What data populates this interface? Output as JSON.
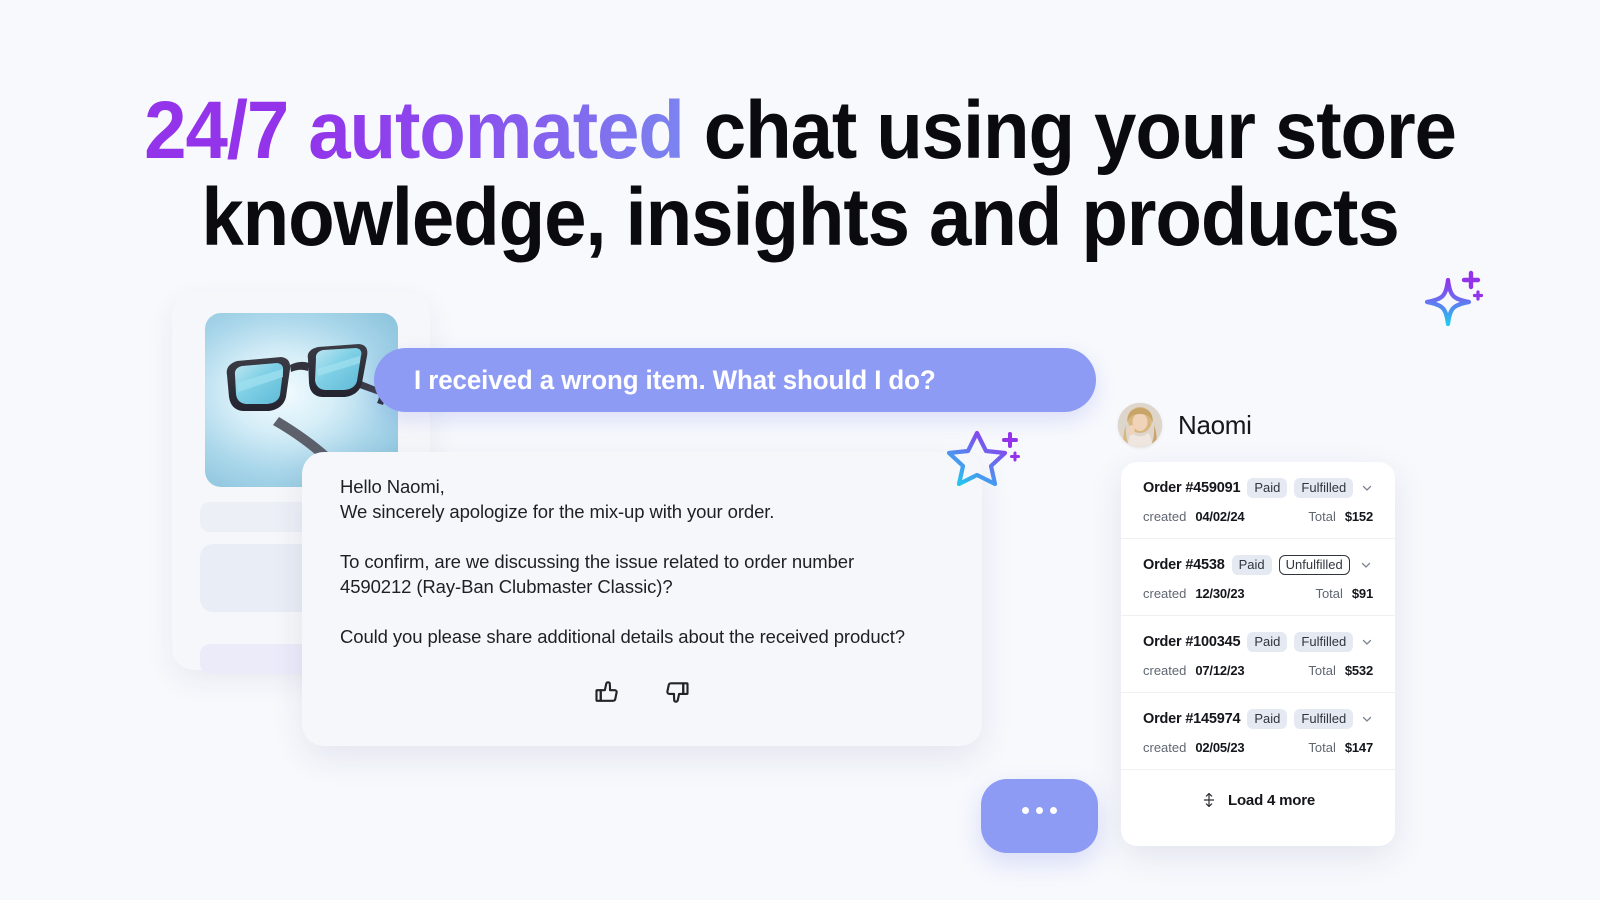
{
  "headline": {
    "gradient_part": "24/7 automated",
    "line1_rest": " chat using your store",
    "line2": "knowledge, insights and products",
    "gradient_from": "#9333EA",
    "gradient_to": "#7B85EF",
    "text_color": "#0B0B0F"
  },
  "product_card": {
    "image_alt": "sunglasses-product-image"
  },
  "chat": {
    "user_message": "I received a wrong item. What should I do?",
    "user_bubble_color": "#8E9BF5",
    "bot_message": {
      "line1": "Hello Naomi,",
      "line2": "We sincerely apologize for the mix-up with your order.",
      "line3": "To confirm, are we discussing the issue related to order number",
      "line4": "4590212 (Ray-Ban Clubmaster Classic)?",
      "line5": "Could you please share additional details about the received product?"
    },
    "thumbs_up": "thumbs-up-icon",
    "thumbs_down": "thumbs-down-icon",
    "typing_indicator": "•••"
  },
  "customer": {
    "name": "Naomi",
    "avatar": "user-avatar-photo"
  },
  "orders_panel": {
    "labels": {
      "created": "created",
      "total": "Total"
    },
    "rows": [
      {
        "id": "Order #459091",
        "status_payment": "Paid",
        "status_fulfillment": "Fulfilled",
        "fulfillment_style": "filled",
        "created": "04/02/24",
        "total": "$152"
      },
      {
        "id": "Order #4538",
        "status_payment": "Paid",
        "status_fulfillment": "Unfulfilled",
        "fulfillment_style": "outline",
        "created": "12/30/23",
        "total": "$91"
      },
      {
        "id": "Order #100345",
        "status_payment": "Paid",
        "status_fulfillment": "Fulfilled",
        "fulfillment_style": "filled",
        "created": "07/12/23",
        "total": "$532"
      },
      {
        "id": "Order #145974",
        "status_payment": "Paid",
        "status_fulfillment": "Fulfilled",
        "fulfillment_style": "filled",
        "created": "02/05/23",
        "total": "$147"
      }
    ],
    "load_more": "Load 4 more",
    "load_more_icon": "expand-vertical-icon",
    "badge_bg": "#E4E9F2"
  },
  "decorations": {
    "sparkle_top_right": "four-point-sparkle-icon",
    "sparkle_middle": "five-point-star-sparkle-icon",
    "gradient_from": "#22C9EE",
    "gradient_to": "#9333EA"
  },
  "background_color": "#F7F9FD"
}
